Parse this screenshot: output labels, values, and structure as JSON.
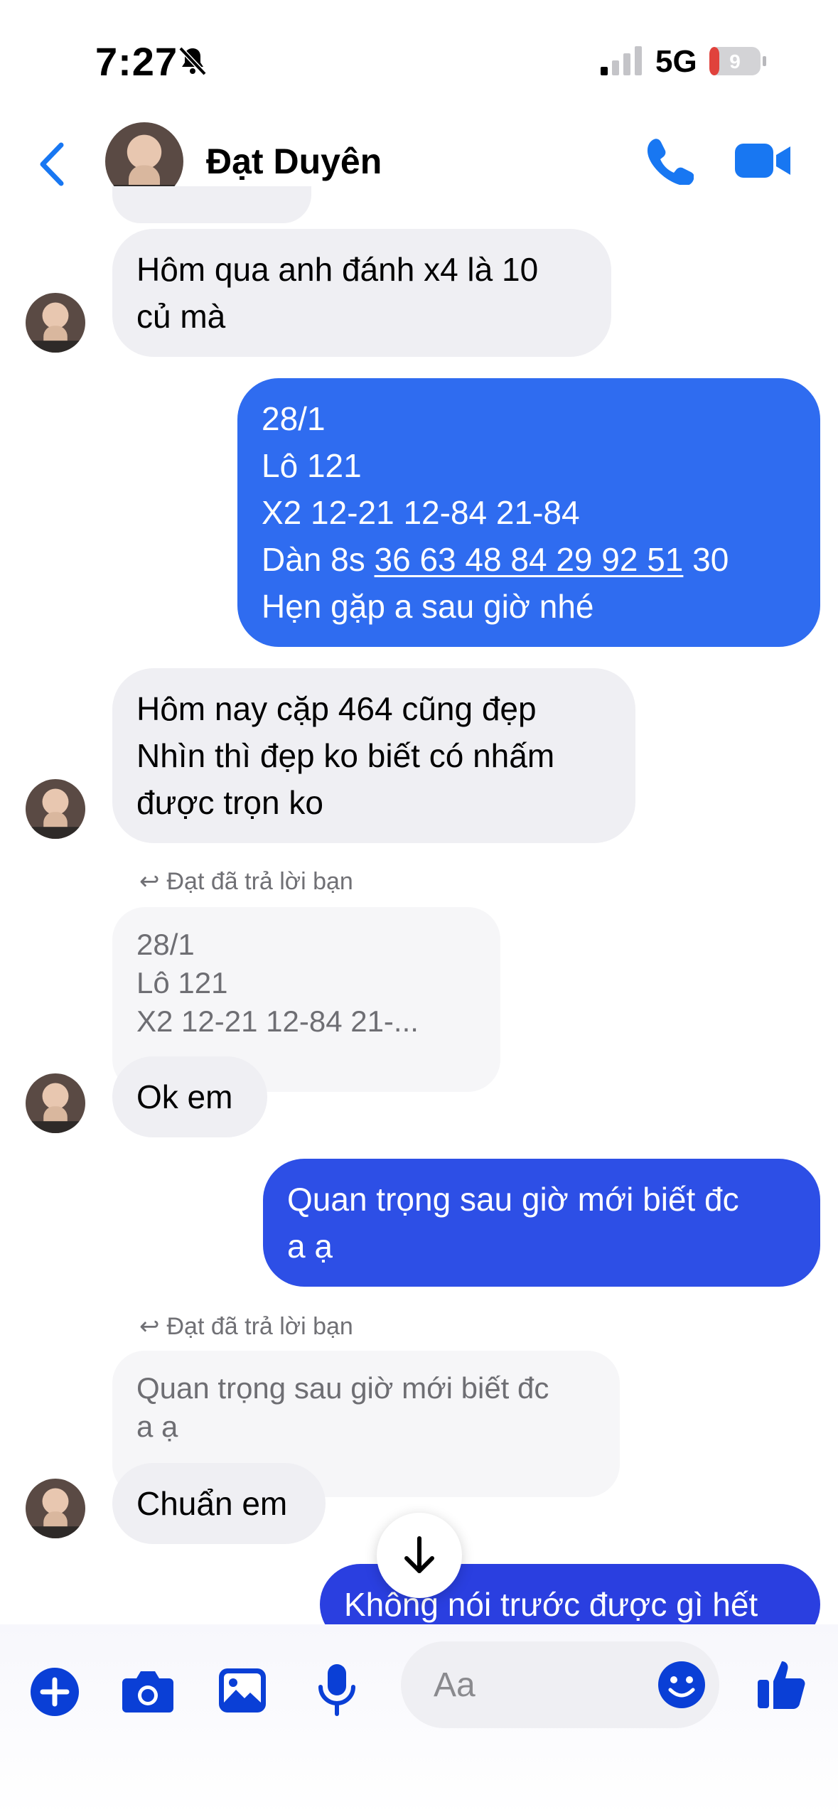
{
  "status_bar": {
    "time": "7:27",
    "network": "5G",
    "battery": "9"
  },
  "header": {
    "contact_name": "Đạt Duyên"
  },
  "messages": {
    "m1": "Hôm qua anh đánh x4 là 10\ncủ mà",
    "m2_lines": [
      "28/1",
      "Lô 121",
      "X2 12-21  12-84  21-84"
    ],
    "m2_dan_prefix": "Dàn 8s ",
    "m2_dan_link": "36 63 48 84 29 92 51",
    "m2_dan_suffix": " 30",
    "m2_last": "Hẹn gặp a sau giờ nhé",
    "m3": "Hôm nay cặp 464 cũng đẹp\nNhìn thì đẹp ko biết có nhấm\nđược trọn ko",
    "reply1_label": "Đạt đã trả lời bạn",
    "reply1_quote": "28/1\nLô 121\nX2 12-21  12-84  21-...",
    "m4": "Ok em",
    "m5": "Quan trọng sau giờ mới biết đc\na ạ",
    "reply2_label": "Đạt đã trả lời bạn",
    "reply2_quote": "Quan trọng sau giờ mới biết đc\na ạ",
    "m6": "Chuẩn em",
    "m7": "Không nói trước được gì hết"
  },
  "composer": {
    "placeholder": "Aa"
  },
  "colors": {
    "accent": "#1877f2",
    "out_top": "#2f6cf0",
    "out_bottom": "#2a3fe0",
    "icon_blue": "#0a3fd6"
  },
  "icons": [
    "back-chevron-icon",
    "phone-icon",
    "video-icon",
    "plus-icon",
    "camera-icon",
    "image-icon",
    "mic-icon",
    "emoji-icon",
    "like-icon",
    "arrow-down-icon",
    "reply-icon",
    "bell-off-icon"
  ]
}
